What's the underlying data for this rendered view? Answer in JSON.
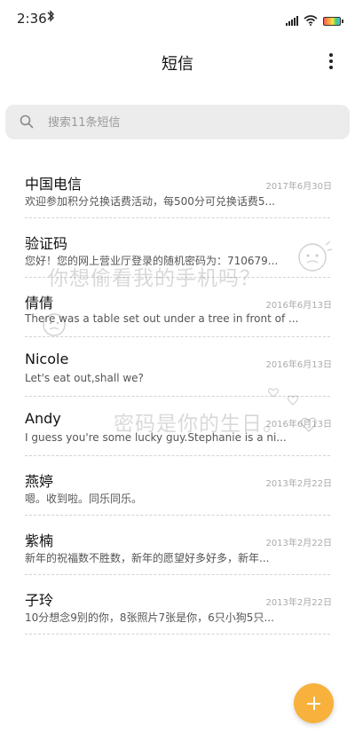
{
  "status_bar": {
    "time": "2:36"
  },
  "header": {
    "title": "短信"
  },
  "search": {
    "placeholder": "搜索11条短信"
  },
  "conversations": [
    {
      "name": "中国电信",
      "date": "2017年6月30日",
      "preview": "欢迎参加积分兑换话费活动，每500分可兑换话费5..."
    },
    {
      "name": "验证码",
      "date": "",
      "preview": "您好！您的网上营业厅登录的随机密码为：710679..."
    },
    {
      "name": "倩倩",
      "date": "2016年6月13日",
      "preview": "There was a table set out under a tree in front of ..."
    },
    {
      "name": "Nicole",
      "date": "2016年6月13日",
      "preview": "Let's eat out,shall we?"
    },
    {
      "name": "Andy",
      "date": "2016年6月13日",
      "preview": "I guess you're some lucky guy.Stephanie is a ni..."
    },
    {
      "name": "燕婷",
      "date": "2013年2月22日",
      "preview": "嗯。收到啦。同乐同乐。"
    },
    {
      "name": "紫楠",
      "date": "2013年2月22日",
      "preview": "新年的祝福数不胜数，新年的愿望好多好多，新年..."
    },
    {
      "name": "子玲",
      "date": "2013年2月22日",
      "preview": "10分想念9别的你，8张照片7张是你，6只小狗5只..."
    }
  ],
  "watermarks": {
    "line1": "你想偷看我的手机吗？",
    "line2": "密码是你的生日。"
  },
  "icons": {
    "search": "search-icon",
    "more": "more-vertical-icon",
    "bluetooth": "bluetooth-icon",
    "signal": "signal-icon",
    "wifi": "wifi-icon",
    "battery": "battery-icon",
    "compose": "plus-icon"
  },
  "colors": {
    "fab": "#f7b13c",
    "search_bg": "#ececec",
    "date": "#aaaaaa"
  }
}
